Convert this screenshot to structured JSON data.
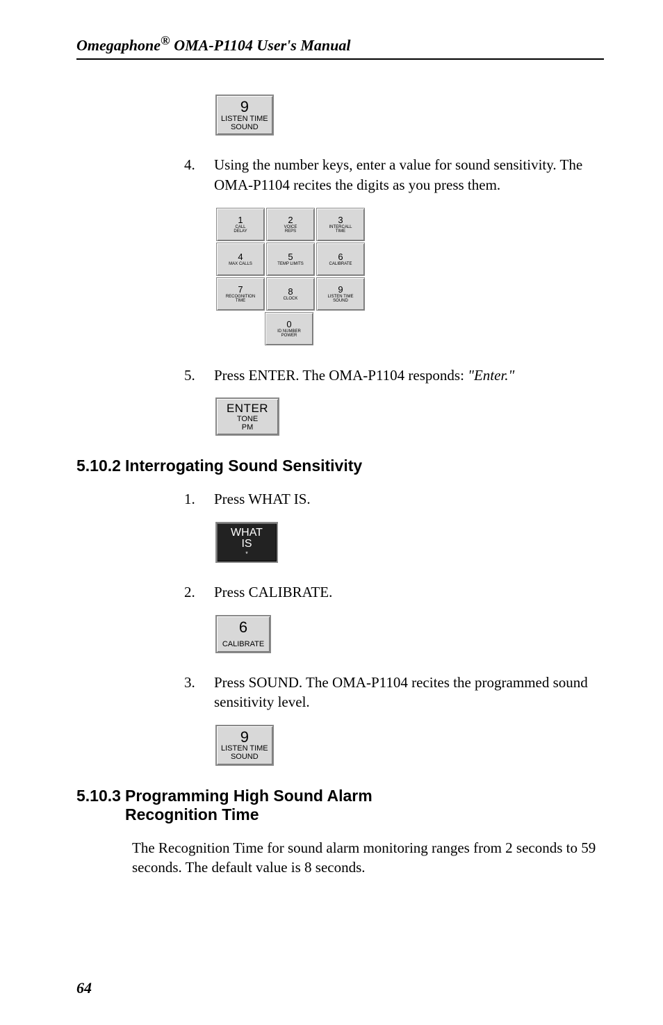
{
  "header": {
    "title_pre": "Omegaphone",
    "title_reg": "®",
    "title_post": " OMA-P1104 User's Manual"
  },
  "key9": {
    "main": "9",
    "l1": "LISTEN TIME",
    "l2": "SOUND"
  },
  "step4": {
    "num": "4.",
    "text": "Using the number keys, enter a value for sound sensitivity. The OMA-P1104 recites the digits as you press them."
  },
  "keypad": [
    [
      {
        "n": "1",
        "l": "CALL\nDELAY"
      },
      {
        "n": "2",
        "l": "VOICE\nREPS"
      },
      {
        "n": "3",
        "l": "INTERCALL\nTIME"
      }
    ],
    [
      {
        "n": "4",
        "l": "MAX CALLS"
      },
      {
        "n": "5",
        "l": "TEMP LIMITS"
      },
      {
        "n": "6",
        "l": "CALIBRATE"
      }
    ],
    [
      {
        "n": "7",
        "l": "RECOGNITION\nTIME"
      },
      {
        "n": "8",
        "l": "CLOCK"
      },
      {
        "n": "9",
        "l": "LISTEN TIME\nSOUND"
      }
    ],
    [
      null,
      {
        "n": "0",
        "l": "ID NUMBER\nPOWER"
      },
      null
    ]
  ],
  "step5": {
    "num": "5.",
    "text_pre": "Press ENTER.  The OMA-P1104 responds: ",
    "text_em": "\"Enter.\""
  },
  "enter_key": {
    "m": "ENTER",
    "s1": "TONE",
    "s2": "PM"
  },
  "sec_5102": {
    "num": "5.10.2",
    "title": "Interrogating Sound Sensitivity"
  },
  "step1b": {
    "num": "1.",
    "text": "Press WHAT IS."
  },
  "whatis_key": {
    "l1": "WHAT",
    "l2": "IS",
    "star": "*"
  },
  "step2b": {
    "num": "2.",
    "text": "Press CALIBRATE."
  },
  "key6": {
    "main": "6",
    "l1": "CALIBRATE"
  },
  "step3b": {
    "num": "3.",
    "text": "Press SOUND. The OMA-P1104 recites the programmed sound sensitivity level."
  },
  "sec_5103": {
    "num": "5.10.3",
    "title_l1": "Programming High Sound Alarm",
    "title_l2": "Recognition Time"
  },
  "body_5103": "The Recognition Time for sound alarm monitoring ranges from 2 seconds to 59 seconds. The default value is 8 seconds.",
  "pgnum": "64"
}
